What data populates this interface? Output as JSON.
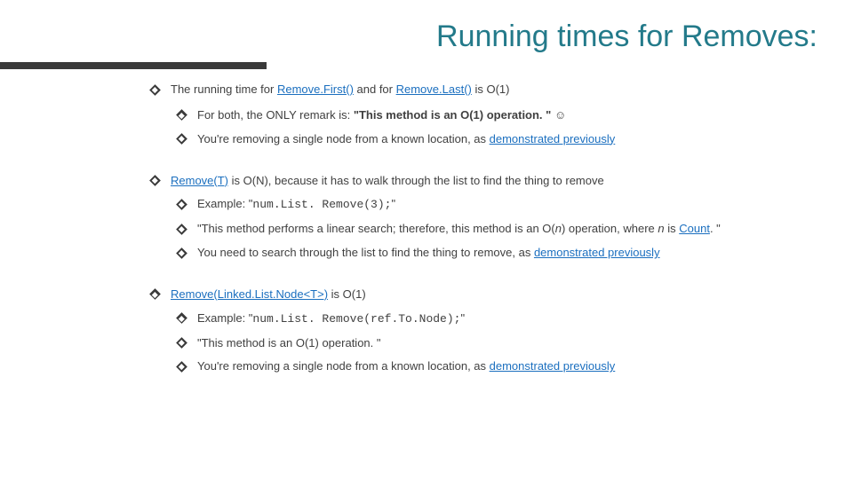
{
  "title": "Running times for Removes:",
  "p1": {
    "t1": "The running time for ",
    "link1": "Remove.First()",
    "t2": " and for ",
    "link2": "Remove.Last()",
    "t3": " is O(1)",
    "sub1_a": "For both, the ONLY remark is: ",
    "sub1_b": "\"This method is an O(1) operation. \"",
    "sub1_c": " ☺",
    "sub2_a": "You're removing a single node from a known location, as ",
    "sub2_link": "demonstrated previously"
  },
  "p2": {
    "link": "Remove(T)",
    "t1": " is O(N), because it has to walk through the list to find the thing to remove",
    "sub1_a": "Example: \"",
    "sub1_code": "num.List. Remove(3);",
    "sub1_b": "\"",
    "sub2_a": "\"This method performs a linear search; therefore, this method is an O(",
    "sub2_i1": "n",
    "sub2_b": ") operation, where ",
    "sub2_i2": "n",
    "sub2_c": " is ",
    "sub2_link": "Count",
    "sub2_d": ". \"",
    "sub3_a": "You need to search through the list to find the thing to remove, as ",
    "sub3_link": "demonstrated previously"
  },
  "p3": {
    "link": "Remove(Linked.List.Node<T>)",
    "t1": " is O(1)",
    "sub1_a": "Example: \"",
    "sub1_code": "num.List. Remove(ref.To.Node);",
    "sub1_b": "\"",
    "sub2": "\"This method is an O(1) operation. \"",
    "sub3_a": "You're removing a single node from a known location, as ",
    "sub3_link": "demonstrated previously"
  }
}
